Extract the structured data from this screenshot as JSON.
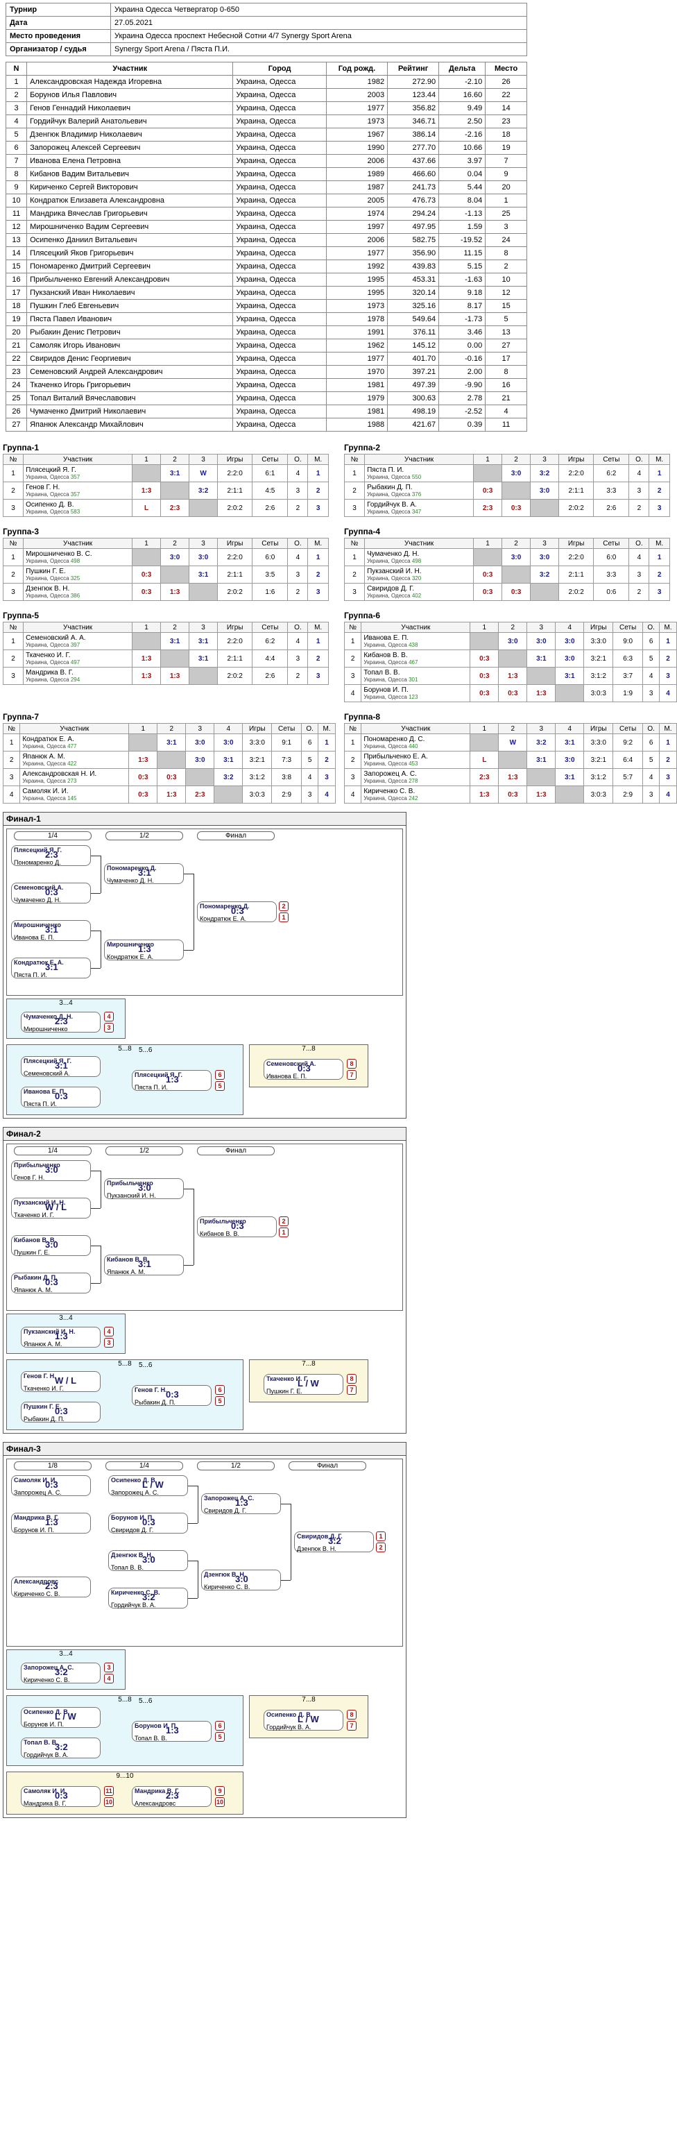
{
  "meta": {
    "rows": [
      {
        "k": "Турнир",
        "v": "Украина Одесса Четвергатор 0-650"
      },
      {
        "k": "Дата",
        "v": "27.05.2021"
      },
      {
        "k": "Место проведения",
        "v": "Украина Одесса проспект Небесной Сотни 4/7 Synergy Sport Arena"
      },
      {
        "k": "Организатор / судья",
        "v": "Synergy Sport Arena / Пяста П.И."
      }
    ]
  },
  "players": {
    "headers": [
      "N",
      "Участник",
      "Город",
      "Год рожд.",
      "Рейтинг",
      "Дельта",
      "Место"
    ],
    "rows": [
      [
        "1",
        "Александровская Надежда Игоревна",
        "Украина, Одесса",
        "1982",
        "272.90",
        "-2.10",
        "26"
      ],
      [
        "2",
        "Борунов Илья Павлович",
        "Украина, Одесса",
        "2003",
        "123.44",
        "16.60",
        "22"
      ],
      [
        "3",
        "Генов Геннадий Николаевич",
        "Украина, Одесса",
        "1977",
        "356.82",
        "9.49",
        "14"
      ],
      [
        "4",
        "Гордийчук Валерий Анатольевич",
        "Украина, Одесса",
        "1973",
        "346.71",
        "2.50",
        "23"
      ],
      [
        "5",
        "Дзенгюк Владимир Николаевич",
        "Украина, Одесса",
        "1967",
        "386.14",
        "-2.16",
        "18"
      ],
      [
        "6",
        "Запорожец Алексей Сергеевич",
        "Украина, Одесса",
        "1990",
        "277.70",
        "10.66",
        "19"
      ],
      [
        "7",
        "Иванова Елена Петровна",
        "Украина, Одесса",
        "2006",
        "437.66",
        "3.97",
        "7"
      ],
      [
        "8",
        "Кибанов Вадим Витальевич",
        "Украина, Одесса",
        "1989",
        "466.60",
        "0.04",
        "9"
      ],
      [
        "9",
        "Кириченко Сергей Викторович",
        "Украина, Одесса",
        "1987",
        "241.73",
        "5.44",
        "20"
      ],
      [
        "10",
        "Кондратюк Елизавета Александровна",
        "Украина, Одесса",
        "2005",
        "476.73",
        "8.04",
        "1"
      ],
      [
        "11",
        "Мандрика Вячеслав Григорьевич",
        "Украина, Одесса",
        "1974",
        "294.24",
        "-1.13",
        "25"
      ],
      [
        "12",
        "Мирошниченко Вадим Сергеевич",
        "Украина, Одесса",
        "1997",
        "497.95",
        "1.59",
        "3"
      ],
      [
        "13",
        "Осипенко Даниил Витальевич",
        "Украина, Одесса",
        "2006",
        "582.75",
        "-19.52",
        "24"
      ],
      [
        "14",
        "Плясецкий Яков Григорьевич",
        "Украина, Одесса",
        "1977",
        "356.90",
        "11.15",
        "8"
      ],
      [
        "15",
        "Пономаренко Дмитрий Сергеевич",
        "Украина, Одесса",
        "1992",
        "439.83",
        "5.15",
        "2"
      ],
      [
        "16",
        "Прибыльченко Евгений Александрович",
        "Украина, Одесса",
        "1995",
        "453.31",
        "-1.63",
        "10"
      ],
      [
        "17",
        "Пукзанский Иван Николаевич",
        "Украина, Одесса",
        "1995",
        "320.14",
        "9.18",
        "12"
      ],
      [
        "18",
        "Пушкин Глеб Евгеньевич",
        "Украина, Одесса",
        "1973",
        "325.16",
        "8.17",
        "15"
      ],
      [
        "19",
        "Пяста Павел Иванович",
        "Украина, Одесса",
        "1978",
        "549.64",
        "-1.73",
        "5"
      ],
      [
        "20",
        "Рыбакин Денис Петрович",
        "Украина, Одесса",
        "1991",
        "376.11",
        "3.46",
        "13"
      ],
      [
        "21",
        "Самоляк Игорь Иванович",
        "Украина, Одесса",
        "1962",
        "145.12",
        "0.00",
        "27"
      ],
      [
        "22",
        "Свиридов Денис Георгиевич",
        "Украина, Одесса",
        "1977",
        "401.70",
        "-0.16",
        "17"
      ],
      [
        "23",
        "Семеновский Андрей Александрович",
        "Украина, Одесса",
        "1970",
        "397.21",
        "2.00",
        "8"
      ],
      [
        "24",
        "Ткаченко Игорь Григорьевич",
        "Украина, Одесса",
        "1981",
        "497.39",
        "-9.90",
        "16"
      ],
      [
        "25",
        "Топал Виталий Вячеславович",
        "Украина, Одесса",
        "1979",
        "300.63",
        "2.78",
        "21"
      ],
      [
        "26",
        "Чумаченко Дмитрий Николаевич",
        "Украина, Одесса",
        "1981",
        "498.19",
        "-2.52",
        "4"
      ],
      [
        "27",
        "Япанюк Александр Михайлович",
        "Украина, Одесса",
        "1988",
        "421.67",
        "0.39",
        "11"
      ]
    ]
  },
  "groups": [
    {
      "title": "Группа-1",
      "n": 3,
      "players": [
        {
          "name": "Плясецкий Я. Г.",
          "rt": "357",
          "res": [
            "",
            "3:1",
            "W"
          ],
          "games": "2:2:0",
          "sets": "6:1",
          "pts": "4",
          "place": "1"
        },
        {
          "name": "Генов Г. Н.",
          "rt": "357",
          "res": [
            "1:3",
            "",
            "3:2"
          ],
          "games": "2:1:1",
          "sets": "4:5",
          "pts": "3",
          "place": "2"
        },
        {
          "name": "Осипенко Д. В.",
          "rt": "583",
          "res": [
            "L",
            "2:3",
            ""
          ],
          "games": "2:0:2",
          "sets": "2:6",
          "pts": "2",
          "place": "3"
        }
      ]
    },
    {
      "title": "Группа-2",
      "n": 3,
      "players": [
        {
          "name": "Пяста П. И.",
          "rt": "550",
          "res": [
            "",
            "3:0",
            "3:2"
          ],
          "games": "2:2:0",
          "sets": "6:2",
          "pts": "4",
          "place": "1"
        },
        {
          "name": "Рыбакин Д. П.",
          "rt": "376",
          "res": [
            "0:3",
            "",
            "3:0"
          ],
          "games": "2:1:1",
          "sets": "3:3",
          "pts": "3",
          "place": "2"
        },
        {
          "name": "Гордийчук В. А.",
          "rt": "347",
          "res": [
            "2:3",
            "0:3",
            ""
          ],
          "games": "2:0:2",
          "sets": "2:6",
          "pts": "2",
          "place": "3"
        }
      ]
    },
    {
      "title": "Группа-3",
      "n": 3,
      "players": [
        {
          "name": "Мирошниченко В. С.",
          "rt": "498",
          "res": [
            "",
            "3:0",
            "3:0"
          ],
          "games": "2:2:0",
          "sets": "6:0",
          "pts": "4",
          "place": "1"
        },
        {
          "name": "Пушкин Г. Е.",
          "rt": "325",
          "res": [
            "0:3",
            "",
            "3:1"
          ],
          "games": "2:1:1",
          "sets": "3:5",
          "pts": "3",
          "place": "2"
        },
        {
          "name": "Дзенгюк В. Н.",
          "rt": "386",
          "res": [
            "0:3",
            "1:3",
            ""
          ],
          "games": "2:0:2",
          "sets": "1:6",
          "pts": "2",
          "place": "3"
        }
      ]
    },
    {
      "title": "Группа-4",
      "n": 3,
      "players": [
        {
          "name": "Чумаченко Д. Н.",
          "rt": "498",
          "res": [
            "",
            "3:0",
            "3:0"
          ],
          "games": "2:2:0",
          "sets": "6:0",
          "pts": "4",
          "place": "1"
        },
        {
          "name": "Пукзанский И. Н.",
          "rt": "320",
          "res": [
            "0:3",
            "",
            "3:2"
          ],
          "games": "2:1:1",
          "sets": "3:3",
          "pts": "3",
          "place": "2"
        },
        {
          "name": "Свиридов Д. Г.",
          "rt": "402",
          "res": [
            "0:3",
            "0:3",
            ""
          ],
          "games": "2:0:2",
          "sets": "0:6",
          "pts": "2",
          "place": "3"
        }
      ]
    },
    {
      "title": "Группа-5",
      "n": 3,
      "players": [
        {
          "name": "Семеновский А. А.",
          "rt": "397",
          "res": [
            "",
            "3:1",
            "3:1"
          ],
          "games": "2:2:0",
          "sets": "6:2",
          "pts": "4",
          "place": "1"
        },
        {
          "name": "Ткаченко И. Г.",
          "rt": "497",
          "res": [
            "1:3",
            "",
            "3:1"
          ],
          "games": "2:1:1",
          "sets": "4:4",
          "pts": "3",
          "place": "2"
        },
        {
          "name": "Мандрика В. Г.",
          "rt": "294",
          "res": [
            "1:3",
            "1:3",
            ""
          ],
          "games": "2:0:2",
          "sets": "2:6",
          "pts": "2",
          "place": "3"
        }
      ]
    },
    {
      "title": "Группа-6",
      "n": 4,
      "players": [
        {
          "name": "Иванова Е. П.",
          "rt": "438",
          "res": [
            "",
            "3:0",
            "3:0",
            "3:0"
          ],
          "games": "3:3:0",
          "sets": "9:0",
          "pts": "6",
          "place": "1"
        },
        {
          "name": "Кибанов В. В.",
          "rt": "467",
          "res": [
            "0:3",
            "",
            "3:1",
            "3:0"
          ],
          "games": "3:2:1",
          "sets": "6:3",
          "pts": "5",
          "place": "2"
        },
        {
          "name": "Топал В. В.",
          "rt": "301",
          "res": [
            "0:3",
            "1:3",
            "",
            "3:1"
          ],
          "games": "3:1:2",
          "sets": "3:7",
          "pts": "4",
          "place": "3"
        },
        {
          "name": "Борунов И. П.",
          "rt": "123",
          "res": [
            "0:3",
            "0:3",
            "1:3",
            ""
          ],
          "games": "3:0:3",
          "sets": "1:9",
          "pts": "3",
          "place": "4"
        }
      ]
    },
    {
      "title": "Группа-7",
      "n": 4,
      "players": [
        {
          "name": "Кондратюк Е. А.",
          "rt": "477",
          "res": [
            "",
            "3:1",
            "3:0",
            "3:0"
          ],
          "games": "3:3:0",
          "sets": "9:1",
          "pts": "6",
          "place": "1"
        },
        {
          "name": "Япанюк А. М.",
          "rt": "422",
          "res": [
            "1:3",
            "",
            "3:0",
            "3:1"
          ],
          "games": "3:2:1",
          "sets": "7:3",
          "pts": "5",
          "place": "2"
        },
        {
          "name": "Александровская Н. И.",
          "rt": "273",
          "res": [
            "0:3",
            "0:3",
            "",
            "3:2"
          ],
          "games": "3:1:2",
          "sets": "3:8",
          "pts": "4",
          "place": "3"
        },
        {
          "name": "Самоляк И. И.",
          "rt": "145",
          "res": [
            "0:3",
            "1:3",
            "2:3",
            ""
          ],
          "games": "3:0:3",
          "sets": "2:9",
          "pts": "3",
          "place": "4"
        }
      ]
    },
    {
      "title": "Группа-8",
      "n": 4,
      "players": [
        {
          "name": "Пономаренко Д. С.",
          "rt": "440",
          "res": [
            "",
            "W",
            "3:2",
            "3:1"
          ],
          "games": "3:3:0",
          "sets": "9:2",
          "pts": "6",
          "place": "1"
        },
        {
          "name": "Прибыльченко Е. А.",
          "rt": "453",
          "res": [
            "L",
            "",
            "3:1",
            "3:0"
          ],
          "games": "3:2:1",
          "sets": "6:4",
          "pts": "5",
          "place": "2"
        },
        {
          "name": "Запорожец А. С.",
          "rt": "278",
          "res": [
            "2:3",
            "1:3",
            "",
            "3:1"
          ],
          "games": "3:1:2",
          "sets": "5:7",
          "pts": "4",
          "place": "3"
        },
        {
          "name": "Кириченко С. В.",
          "rt": "242",
          "res": [
            "1:3",
            "0:3",
            "1:3",
            ""
          ],
          "games": "3:0:3",
          "sets": "2:9",
          "pts": "3",
          "place": "4"
        }
      ]
    }
  ],
  "finals": [
    {
      "title": "Финал-1",
      "rounds": [
        "1/4",
        "1/2",
        "Финал"
      ],
      "qf": [
        {
          "a": "Плясецкий Я. Г.",
          "b": "Пономаренко Д.",
          "score": "2:3",
          "n": "9"
        },
        {
          "a": "Семеновский А.",
          "b": "Чумаченко Д. Н.",
          "score": "0:3",
          "n": "10"
        },
        {
          "a": "Мирошниченко",
          "b": "Иванова Е. П.",
          "score": "3:1",
          "n": "11"
        },
        {
          "a": "Кондратюк Е. А.",
          "b": "Пяста П. И.",
          "score": "3:1",
          "n": "12"
        }
      ],
      "sf": [
        {
          "a": "Пономаренко Д.",
          "b": "Чумаченко Д. Н.",
          "score": "3:1"
        },
        {
          "a": "Мирошниченко",
          "b": "Кондратюк Е. А.",
          "score": "1:3"
        }
      ],
      "f": {
        "a": "Пономаренко Д.",
        "b": "Кондратюк Е. А.",
        "score": "0:3"
      },
      "places": [
        "2",
        "1"
      ],
      "p34": {
        "title": "3...4",
        "a": "Чумаченко Д. Н.",
        "b": "Мирошниченко",
        "score": "2:3",
        "pl": [
          "4",
          "3"
        ]
      },
      "p58": {
        "title": "5...8",
        "m1": {
          "a": "Плясецкий Я. Г.",
          "b": "Семеновский А.",
          "score": "3:1"
        },
        "m2": {
          "a": "Иванова Е. П.",
          "b": "Пяста П. И.",
          "score": "0:3"
        }
      },
      "p56": {
        "title": "5...6",
        "a": "Плясецкий Я. Г.",
        "b": "Пяста П. И.",
        "score": "1:3",
        "pl": [
          "6",
          "5"
        ]
      },
      "p78": {
        "title": "7...8",
        "a": "Семеновский А.",
        "b": "Иванова Е. П.",
        "score": "0:3",
        "pl": [
          "8",
          "7"
        ]
      }
    },
    {
      "title": "Финал-2",
      "rounds": [
        "1/4",
        "1/2",
        "Финал"
      ],
      "qf": [
        {
          "a": "Прибыльченко",
          "b": "Генов Г. Н.",
          "score": "3:0",
          "n": "5"
        },
        {
          "a": "Пукзанский И. Н.",
          "b": "Ткаченко И. Г.",
          "score": "W / L",
          "n": "6"
        },
        {
          "a": "Кибанов В. В.",
          "b": "Пушкин Г. Е.",
          "score": "3:0",
          "n": "7"
        },
        {
          "a": "Рыбакин Д. П.",
          "b": "Япанюк А. М.",
          "score": "0:3",
          "n": "8"
        }
      ],
      "sf": [
        {
          "a": "Прибыльченко",
          "b": "Пукзанский И. Н.",
          "score": "3:0"
        },
        {
          "a": "Кибанов В. В.",
          "b": "Япанюк А. М.",
          "score": "3:1"
        }
      ],
      "f": {
        "a": "Прибыльченко",
        "b": "Кибанов В. В.",
        "score": "0:3"
      },
      "places": [
        "2",
        "1"
      ],
      "p34": {
        "title": "3...4",
        "a": "Пукзанский И. Н.",
        "b": "Япанюк А. М.",
        "score": "1:3",
        "pl": [
          "4",
          "3"
        ]
      },
      "p58": {
        "title": "5...8",
        "m1": {
          "a": "Генов Г. Н.",
          "b": "Ткаченко И. Г.",
          "score": "W / L"
        },
        "m2": {
          "a": "Пушкин Г. Е.",
          "b": "Рыбакин Д. П.",
          "score": "0:3"
        }
      },
      "p56": {
        "title": "5...6",
        "a": "Генов Г. Н.",
        "b": "Рыбакин Д. П.",
        "score": "0:3",
        "pl": [
          "6",
          "5"
        ]
      },
      "p78": {
        "title": "7...8",
        "a": "Ткаченко И. Г.",
        "b": "Пушкин Г. Е.",
        "score": "L / W",
        "pl": [
          "8",
          "7"
        ]
      }
    },
    {
      "title": "Финал-3",
      "rounds": [
        "1/8",
        "1/4",
        "1/2",
        "Финал"
      ],
      "r8": [
        {
          "a": "Самоляк И. И.",
          "b": "Запорожец А. С.",
          "score": "0:3",
          "n": "16"
        },
        {
          "a": "Мандрика В. Г.",
          "b": "Борунов И. П.",
          "score": "1:3",
          "n": "15"
        },
        {
          "a": "Александровс",
          "b": "Кириченко С. В.",
          "score": "2:3",
          "n": "14"
        }
      ],
      "qf": [
        {
          "a": "Осипенко Д. В.",
          "b": "Запорожец А. С.",
          "score": "L / W"
        },
        {
          "a": "Борунов И. П.",
          "b": "Свиридов Д. Г.",
          "score": "0:3"
        },
        {
          "a": "Дзенгюк В. Н.",
          "b": "Топал В. В.",
          "score": "3:0"
        },
        {
          "a": "Кириченко С. В.",
          "b": "Гордийчук В. А.",
          "score": "3:2"
        }
      ],
      "sf": [
        {
          "a": "Запорожец А. С.",
          "b": "Свиридов Д. Г.",
          "score": "1:3"
        },
        {
          "a": "Дзенгюк В. Н.",
          "b": "Кириченко С. В.",
          "score": "3:0"
        }
      ],
      "f": {
        "a": "Свиридов Д. Г.",
        "b": "Дзенгюк В. Н.",
        "score": "3:2"
      },
      "places": [
        "1",
        "2"
      ],
      "p34": {
        "title": "3...4",
        "a": "Запорожец А. С.",
        "b": "Кириченко С. В.",
        "score": "3:2",
        "pl": [
          "3",
          "4"
        ]
      },
      "p58": {
        "title": "5...8",
        "m1": {
          "a": "Осипенко Д. В.",
          "b": "Борунов И. П.",
          "score": "L / W"
        },
        "m2": {
          "a": "Топал В. В.",
          "b": "Гордийчук В. А.",
          "score": "3:2"
        }
      },
      "p56": {
        "title": "5...6",
        "a": "Борунов И. П.",
        "b": "Топал В. В.",
        "score": "1:3",
        "pl": [
          "6",
          "5"
        ]
      },
      "p78": {
        "title": "7...8",
        "a": "Осипенко Д. В.",
        "b": "Гордийчук В. А.",
        "score": "L / W",
        "pl": [
          "8",
          "7"
        ]
      },
      "p910": {
        "title": "9...10",
        "m1": {
          "a": "Самоляк И. И.",
          "b": "Мандрика В. Г.",
          "score": "0:3",
          "pl": [
            "11",
            "10"
          ]
        },
        "m2": {
          "a": "Мандрика В. Г.",
          "b": "Александровс",
          "score": "2:3",
          "pl": [
            "9",
            "10"
          ]
        }
      }
    }
  ]
}
